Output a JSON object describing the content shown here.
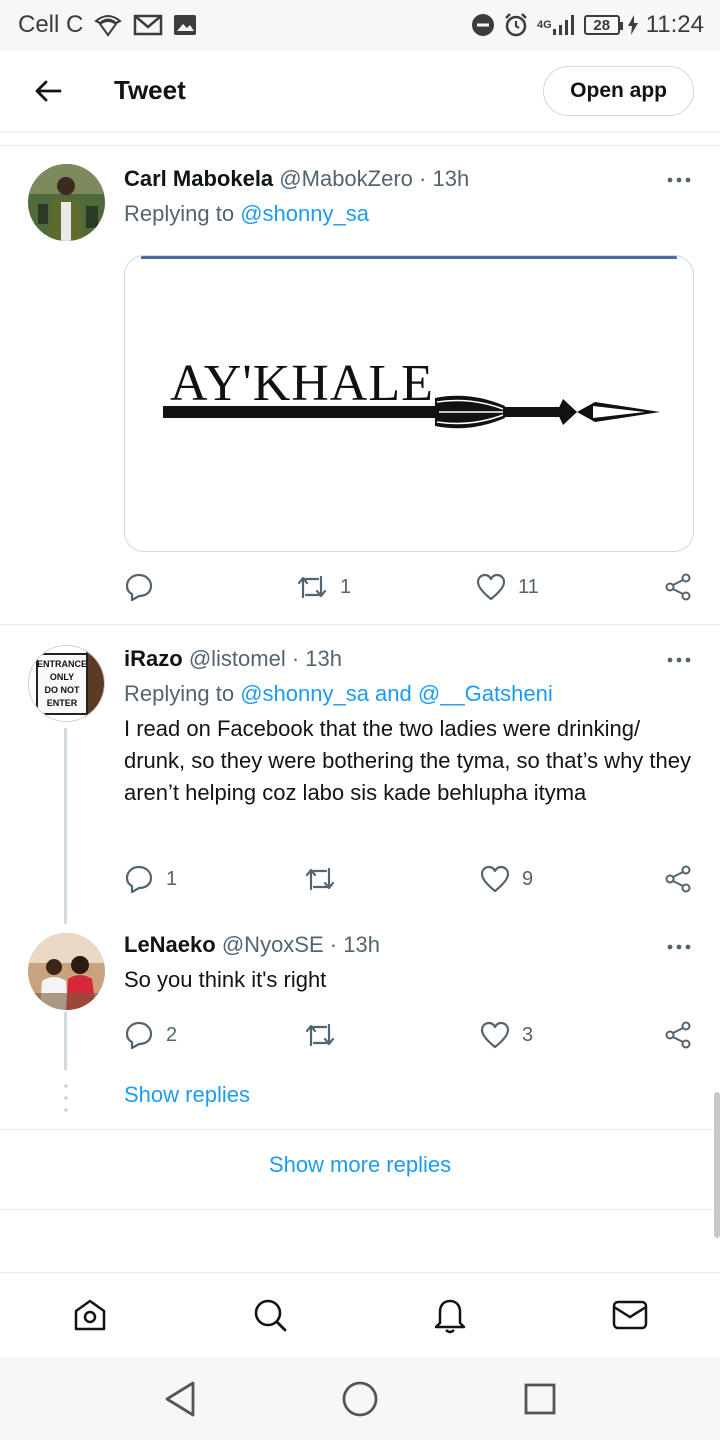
{
  "status_bar": {
    "carrier": "Cell C",
    "network": "4G",
    "battery": "28",
    "time": "11:24"
  },
  "header": {
    "title": "Tweet",
    "open_app_label": "Open app"
  },
  "tweets": [
    {
      "name": "Carl Mabokela",
      "handle": "@MabokZero",
      "time": "· 13h",
      "replying_prefix": "Replying to",
      "replying_to": "@shonny_sa",
      "media_text": "AY'KHALE",
      "stats": {
        "replies": "",
        "retweets": "1",
        "likes": "11"
      }
    },
    {
      "name": "iRazo",
      "handle": "@listomel",
      "time": "· 13h",
      "replying_prefix": "Replying to",
      "replying_to": "@shonny_sa and @__Gatsheni",
      "avatar_sign": [
        "ENTRANCE",
        "ONLY",
        "DO NOT",
        "ENTER"
      ],
      "text": "I read on Facebook that the two ladies were drinking/ drunk, so they were bothering the tyma, so that’s why they aren’t helping coz labo sis kade behlupha ityma",
      "stats": {
        "replies": "1",
        "retweets": "",
        "likes": "9"
      }
    },
    {
      "name": "LeNaeko",
      "handle": "@NyoxSE",
      "time": "· 13h",
      "text": "So you think it's right",
      "stats": {
        "replies": "2",
        "retweets": "",
        "likes": "3"
      }
    }
  ],
  "show_replies_label": "Show replies",
  "show_more_replies_label": "Show more replies",
  "bottom_nav": [
    "home-icon",
    "search-icon",
    "notifications-icon",
    "messages-icon"
  ],
  "colors": {
    "accent": "#1d9bf0",
    "text_primary": "#0f1419",
    "text_secondary": "#536471",
    "border": "#cfd9de"
  }
}
